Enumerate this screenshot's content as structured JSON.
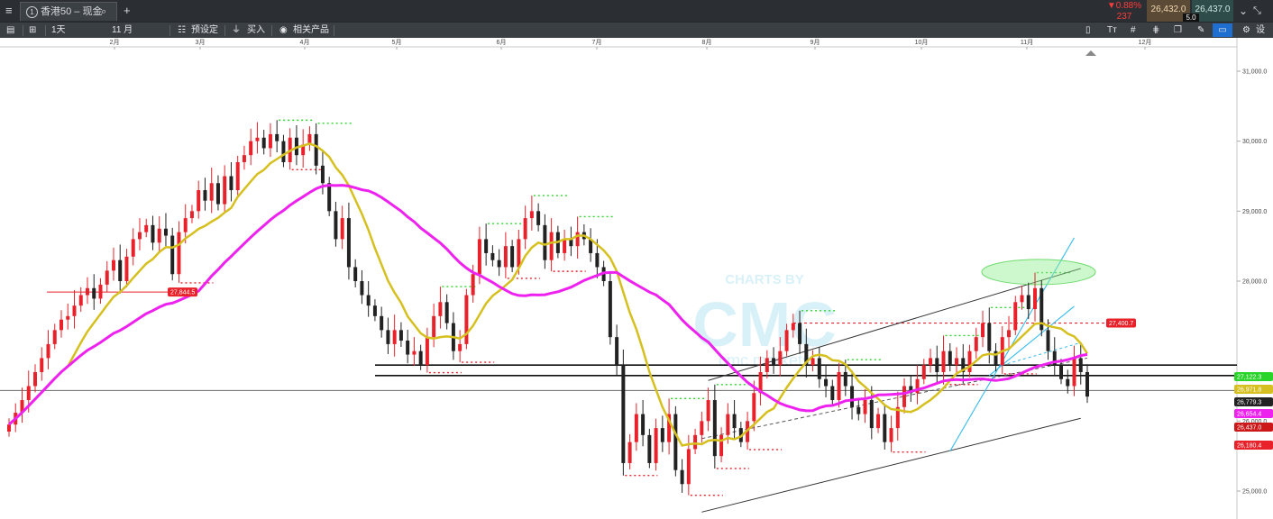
{
  "window": {
    "tab_number": "1",
    "tab_title": "香港50 – 现金",
    "add_tab": "+",
    "change_pct": "0.88%",
    "change_pts": "237",
    "sell_price": "26,432.0",
    "buy_price": "26,437.0",
    "spread": "5.0"
  },
  "toolbar": {
    "interval": "1天",
    "range": "11 月",
    "presets": "预设定",
    "buy": "买入",
    "related": "相关产品",
    "settings": "设置"
  },
  "colors": {
    "up": "#e8212a",
    "down": "#222222",
    "ma_short": "#d6c020",
    "ma_long": "#ee22ee",
    "support_dots": "#e8212a",
    "resistance_dots": "#2bd42b",
    "channel_blue": "#33bbee",
    "ellipse": "#90ee90"
  },
  "chart_data": {
    "type": "candlestick",
    "x_labels": [
      "2月",
      "3月",
      "4月",
      "5月",
      "6月",
      "7月",
      "8月",
      "9月",
      "10月",
      "11月",
      "12月"
    ],
    "y_ticks": [
      "31,000.0",
      "30,000.0",
      "29,000.0",
      "28,000.0",
      "26,000.0",
      "25,000.0"
    ],
    "ylim": [
      24800,
      31300
    ],
    "price_labels": [
      {
        "text": "27,844.5",
        "value": 27844.5,
        "color": "#e8212a"
      },
      {
        "text": "27,400.7",
        "value": 27400.7,
        "color": "#e8212a"
      },
      {
        "text": "27,122.3",
        "value": 27122.3,
        "color": "#2bd42b"
      },
      {
        "text": "26,971.8",
        "value": 26971.8,
        "color": "#d6c020"
      },
      {
        "text": "26,779.3",
        "value": 26779.3,
        "color": "#222222"
      },
      {
        "text": "26,654.4",
        "value": 26654.4,
        "color": "#ee22ee"
      },
      {
        "text": "26,437.0",
        "value": 26437.0,
        "color": "#cc1818"
      },
      {
        "text": "26,180.4",
        "value": 26180.4,
        "color": "#e8212a"
      }
    ],
    "current_price": 26437.0,
    "horizontal_lines": [
      26800,
      26650
    ],
    "watermark": [
      "CHARTS BY",
      "CMC",
      "cmc markets"
    ],
    "close": [
      25950,
      26120,
      26300,
      26500,
      26700,
      26900,
      27100,
      27300,
      27450,
      27500,
      27650,
      27800,
      27900,
      27750,
      27950,
      28150,
      28300,
      28000,
      28350,
      28600,
      28700,
      28800,
      28550,
      28750,
      28650,
      28100,
      28700,
      28900,
      29000,
      29300,
      29150,
      29400,
      29100,
      29500,
      29300,
      29700,
      29800,
      30000,
      30050,
      29900,
      30100,
      30000,
      29700,
      30050,
      29800,
      29950,
      30100,
      29650,
      29400,
      29000,
      28600,
      28900,
      28200,
      28000,
      27800,
      27650,
      27500,
      27300,
      27100,
      27300,
      27150,
      26950,
      27000,
      26800,
      27200,
      27500,
      27700,
      27400,
      27000,
      27100,
      27800,
      28100,
      28600,
      28400,
      28300,
      28200,
      28500,
      28200,
      28600,
      28900,
      29000,
      28800,
      28300,
      28700,
      28400,
      28600,
      28500,
      28700,
      28600,
      28400,
      28200,
      28000,
      27200,
      26800,
      25400,
      25700,
      26100,
      25800,
      25400,
      25900,
      25700,
      26100,
      25300,
      25100,
      25600,
      25800,
      26000,
      26300,
      25500,
      25800,
      26100,
      25900,
      25700,
      26000,
      26400,
      26700,
      26900,
      26800,
      27000,
      27300,
      27400,
      27100,
      26800,
      26900,
      26600,
      26500,
      26300,
      26700,
      26500,
      26200,
      26100,
      26300,
      25900,
      26100,
      25700,
      25900,
      26200,
      26500,
      26400,
      26600,
      26800,
      26900,
      26700,
      27000,
      26800,
      26900,
      26700,
      27000,
      27200,
      27400,
      27000,
      26800,
      27200,
      27300,
      27700,
      27800,
      27600,
      27900,
      27300,
      27000,
      26800,
      26600,
      26500,
      26900,
      26700,
      26350
    ]
  }
}
